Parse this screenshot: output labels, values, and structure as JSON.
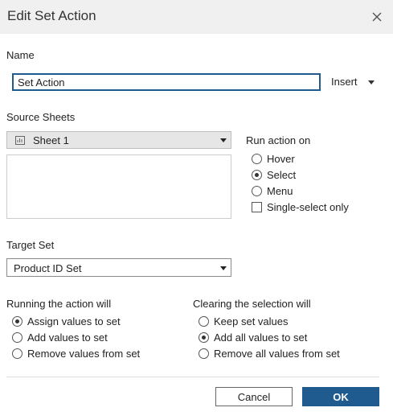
{
  "dialog": {
    "title": "Edit Set Action",
    "close_icon": "close-icon"
  },
  "name_section": {
    "label": "Name",
    "value": "Set Action",
    "insert_label": "Insert"
  },
  "source_sheets": {
    "label": "Source Sheets",
    "selected": "Sheet 1",
    "sheet_icon": "worksheet-icon",
    "list_items": []
  },
  "run_action_on": {
    "label": "Run action on",
    "options": [
      {
        "label": "Hover",
        "checked": false
      },
      {
        "label": "Select",
        "checked": true
      },
      {
        "label": "Menu",
        "checked": false
      }
    ],
    "single_select": {
      "label": "Single-select only",
      "checked": false
    }
  },
  "target_set": {
    "label": "Target Set",
    "selected": "Product ID Set"
  },
  "running_action": {
    "label": "Running the action will",
    "options": [
      {
        "label": "Assign values to set",
        "checked": true
      },
      {
        "label": "Add values to set",
        "checked": false
      },
      {
        "label": "Remove values from set",
        "checked": false
      }
    ]
  },
  "clearing_selection": {
    "label": "Clearing the selection will",
    "options": [
      {
        "label": "Keep set values",
        "checked": false
      },
      {
        "label": "Add all values to set",
        "checked": true
      },
      {
        "label": "Remove all values from set",
        "checked": false
      }
    ]
  },
  "buttons": {
    "cancel": "Cancel",
    "ok": "OK"
  },
  "colors": {
    "accent": "#1f5b8f",
    "titlebar_bg": "#f0f0f0",
    "select_bg": "#e6e6e6"
  }
}
